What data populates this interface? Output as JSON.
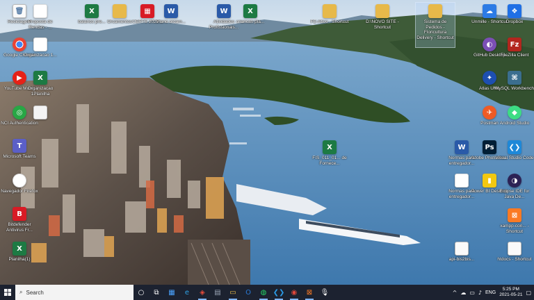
{
  "desktop": {
    "icons": [
      {
        "label": "Reciclagem",
        "glyph": "🗑",
        "cls": "g-blank"
      },
      {
        "label": "Proposta de Rendas - ...",
        "glyph": "PDF",
        "cls": "g-pdf"
      },
      {
        "label": "Google Chrome",
        "glyph": "",
        "cls": "g-chrome"
      },
      {
        "label": "Organizacao 1...",
        "glyph": "PDF",
        "cls": "g-pdf"
      },
      {
        "label": "YouTube Music",
        "glyph": "▶",
        "cls": "g-yt"
      },
      {
        "label": "Organizacao 1Planilha",
        "glyph": "X",
        "cls": "g-xls"
      },
      {
        "label": "NCI Authentication",
        "glyph": "◎",
        "cls": "g-win"
      },
      {
        "label": "",
        "glyph": "",
        "cls": "g-doc-blank"
      },
      {
        "label": "Microsoft Teams",
        "glyph": "T",
        "cls": "g-teams"
      },
      {
        "label": "Navegador Firefox",
        "glyph": "◉",
        "cls": "g-nav"
      },
      {
        "label": "Bitdefender Antivirus Fr...",
        "glyph": "B",
        "cls": "g-red"
      },
      {
        "label": "Planilha(1)",
        "glyph": "X",
        "cls": "g-xls"
      },
      {
        "label": "balanco pre...",
        "glyph": "X",
        "cls": "g-xls"
      },
      {
        "label": "Orcamentos",
        "glyph": "",
        "cls": "g-folder"
      },
      {
        "label": "CERTS 2021...",
        "glyph": "▦",
        "cls": "g-red"
      },
      {
        "label": "Plano orcam...",
        "glyph": "W",
        "cls": "g-doc"
      },
      {
        "label": "Atividades Profissionais...",
        "glyph": "W",
        "cls": "g-doc"
      },
      {
        "label": "criancas-pla...",
        "glyph": "X",
        "cls": "g-xls"
      },
      {
        "label": "FE-Ativo - Shortcut",
        "glyph": "",
        "cls": "g-folder-sc"
      },
      {
        "label": "D:\\NOVO SITE - Shortcut",
        "glyph": "",
        "cls": "g-folder-sc"
      },
      {
        "label": "Sistema de Pedidos - Floricultura Delivery - Shortcut",
        "glyph": "",
        "cls": "g-folder-sc"
      },
      {
        "label": "FIS_011_01... de Fornece...",
        "glyph": "X",
        "cls": "g-xls"
      },
      {
        "label": "Unmille - Shortcut",
        "glyph": "☁",
        "cls": "g-onedrive"
      },
      {
        "label": "Dropbox",
        "glyph": "❖",
        "cls": "g-dropbox"
      },
      {
        "label": "GitHub Desktop",
        "glyph": "◐",
        "cls": "g-github"
      },
      {
        "label": "FileZilla Client",
        "glyph": "Fz",
        "cls": "g-fz"
      },
      {
        "label": "Atlas UML",
        "glyph": "✦",
        "cls": "g-atlas"
      },
      {
        "label": "MySQL Workbench",
        "glyph": "⌘",
        "cls": "g-mysql"
      },
      {
        "label": "Postman",
        "glyph": "✈",
        "cls": "g-postman"
      },
      {
        "label": "Android Studio",
        "glyph": "◆",
        "cls": "g-android"
      },
      {
        "label": "Normas para entregador...",
        "glyph": "W",
        "cls": "g-doc"
      },
      {
        "label": "Adobe Photosho...",
        "glyph": "Ps",
        "cls": "g-ps"
      },
      {
        "label": "Visual Studio Code",
        "glyph": "❮❯",
        "cls": "g-vscode"
      },
      {
        "label": "Normas para entregador...",
        "glyph": "PDF",
        "cls": "g-pdf"
      },
      {
        "label": "Power BI Desktop",
        "glyph": "▮",
        "cls": "g-powerbi"
      },
      {
        "label": "Eclipse IDE for Java De...",
        "glyph": "◑",
        "cls": "g-eclipse"
      },
      {
        "label": "xampp-con... - Shortcut",
        "glyph": "⊠",
        "cls": "g-xampp"
      },
      {
        "label": "api-bis2bis...",
        "glyph": "",
        "cls": "g-blank"
      },
      {
        "label": "htdocs - Shortcut",
        "glyph": "",
        "cls": "g-blank"
      }
    ]
  },
  "taskbar": {
    "search_placeholder": "Search",
    "apps": [
      {
        "name": "cortana-button",
        "glyph": "○",
        "color": "#ffffff"
      },
      {
        "name": "task-view-button",
        "glyph": "⧉",
        "color": "#ffffff"
      },
      {
        "name": "taskbar-app-calendar",
        "glyph": "▦",
        "color": "#4aa3ff"
      },
      {
        "name": "taskbar-app-edge",
        "glyph": "e",
        "color": "#2fa3e6"
      },
      {
        "name": "taskbar-app-bitdefender",
        "glyph": "◈",
        "color": "#e44b3a"
      },
      {
        "name": "taskbar-app-calculator",
        "glyph": "▤",
        "color": "#9aa4b5"
      },
      {
        "name": "taskbar-app-file-explorer",
        "glyph": "▭",
        "color": "#f0c04a"
      },
      {
        "name": "taskbar-app-outlook",
        "glyph": "O",
        "color": "#2a7ad6"
      },
      {
        "name": "taskbar-app-whatsapp",
        "glyph": "◍",
        "color": "#25d366"
      },
      {
        "name": "taskbar-app-vscode",
        "glyph": "❮❯",
        "color": "#2b9be6"
      },
      {
        "name": "taskbar-app-chrome",
        "glyph": "◉",
        "color": "#e0473b"
      },
      {
        "name": "taskbar-app-xampp",
        "glyph": "⊠",
        "color": "#fb7a24"
      },
      {
        "name": "taskbar-app-voice",
        "glyph": "🎙",
        "color": "#ffffff"
      }
    ],
    "tray": {
      "language": "ENG",
      "time": "5:25 PM",
      "date": "2021-05-21"
    }
  }
}
